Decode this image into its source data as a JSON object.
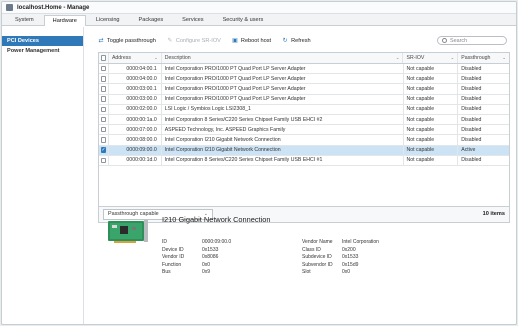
{
  "window": {
    "title": "localhost.Home - Manage"
  },
  "tabs": [
    "System",
    "Hardware",
    "Licensing",
    "Packages",
    "Services",
    "Security & users"
  ],
  "active_tab": "Hardware",
  "sidebar": {
    "items": [
      "PCI Devices",
      "Power Management"
    ],
    "selected": "PCI Devices"
  },
  "toolbar": {
    "toggle_passthrough": "Toggle passthrough",
    "configure_sriov": "Configure SR-IOV",
    "reboot_host": "Reboot host",
    "refresh": "Refresh",
    "search_placeholder": "Search"
  },
  "grid": {
    "columns": [
      "Address",
      "Description",
      "SR-IOV",
      "Passthrough"
    ],
    "rows": [
      {
        "address": "0000:04:00.1",
        "description": "Intel Corporation PRO/1000 PT Quad Port LP Server Adapter",
        "sriov": "Not capable",
        "passthrough": "Disabled",
        "checked": false
      },
      {
        "address": "0000:04:00.0",
        "description": "Intel Corporation PRO/1000 PT Quad Port LP Server Adapter",
        "sriov": "Not capable",
        "passthrough": "Disabled",
        "checked": false
      },
      {
        "address": "0000:03:00.1",
        "description": "Intel Corporation PRO/1000 PT Quad Port LP Server Adapter",
        "sriov": "Not capable",
        "passthrough": "Disabled",
        "checked": false
      },
      {
        "address": "0000:03:00.0",
        "description": "Intel Corporation PRO/1000 PT Quad Port LP Server Adapter",
        "sriov": "Not capable",
        "passthrough": "Disabled",
        "checked": false
      },
      {
        "address": "0000:02:00.0",
        "description": "LSI Logic / Symbios Logic LSI2308_1",
        "sriov": "Not capable",
        "passthrough": "Disabled",
        "checked": false
      },
      {
        "address": "0000:00:1a.0",
        "description": "Intel Corporation 8 Series/C220 Series Chipset Family USB EHCI #2",
        "sriov": "Not capable",
        "passthrough": "Disabled",
        "checked": false
      },
      {
        "address": "0000:07:00.0",
        "description": "ASPEED Technology, Inc. ASPEED Graphics Family",
        "sriov": "Not capable",
        "passthrough": "Disabled",
        "checked": false
      },
      {
        "address": "0000:08:00.0",
        "description": "Intel Corporation I210 Gigabit Network Connection",
        "sriov": "Not capable",
        "passthrough": "Disabled",
        "checked": false
      },
      {
        "address": "0000:09:00.0",
        "description": "Intel Corporation I210 Gigabit Network Connection",
        "sriov": "Not capable",
        "passthrough": "Active",
        "checked": true,
        "selected": true
      },
      {
        "address": "0000:00:1d.0",
        "description": "Intel Corporation 8 Series/C220 Series Chipset Family USB EHCI #1",
        "sriov": "Not capable",
        "passthrough": "Disabled",
        "checked": false
      }
    ],
    "filter_value": "Passthrough capable",
    "count": "10 items"
  },
  "detail": {
    "title": "I210 Gigabit Network Connection",
    "left": [
      {
        "k": "ID",
        "v": "0000:09:00.0"
      },
      {
        "k": "Device ID",
        "v": "0x1533"
      },
      {
        "k": "Vendor ID",
        "v": "0x8086"
      },
      {
        "k": "Function",
        "v": "0x0"
      },
      {
        "k": "Bus",
        "v": "0x9"
      }
    ],
    "right": [
      {
        "k": "Vendor Name",
        "v": "Intel Corporation"
      },
      {
        "k": "Class ID",
        "v": "0x200"
      },
      {
        "k": "Subdevice ID",
        "v": "0x1533"
      },
      {
        "k": "Subvendor ID",
        "v": "0x15d9"
      },
      {
        "k": "Slot",
        "v": "0x0"
      }
    ]
  },
  "colors": {
    "accent": "#2f79b8",
    "selected_row": "#cce3f5"
  }
}
